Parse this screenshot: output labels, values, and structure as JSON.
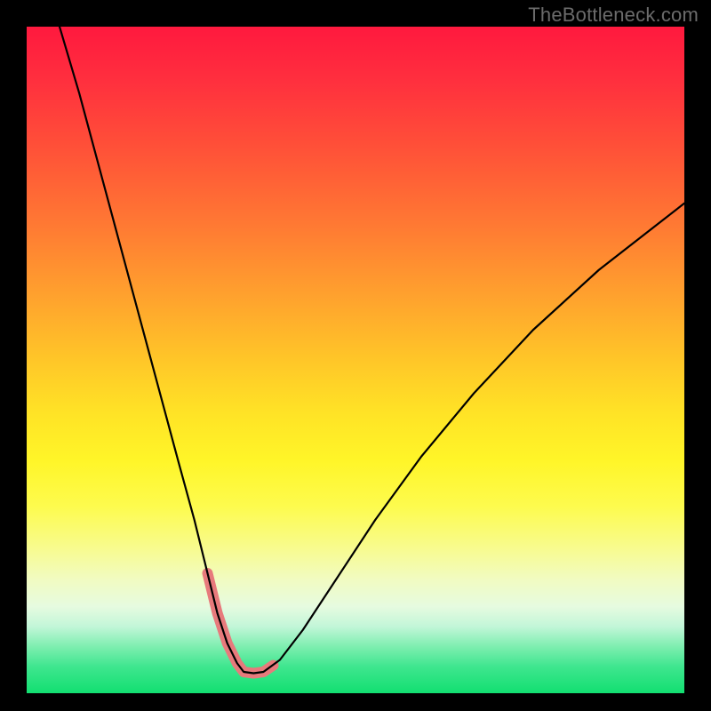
{
  "watermark": "TheBottleneck.com",
  "chart_data": {
    "type": "line",
    "title": "",
    "xlabel": "",
    "ylabel": "",
    "xlim": [
      0,
      100
    ],
    "ylim": [
      0,
      100
    ],
    "grid": false,
    "legend": false,
    "notes": "Unlabeled bottleneck curve on a green→red vertical gradient background. The minimum of the curve sits near x≈32, y≈3. A short salmon-colored segment highlights the region around the minimum. Values are estimated from pixel positions since no axis ticks are rendered.",
    "series": [
      {
        "name": "curve",
        "color": "#000000",
        "stroke_width": 2.2,
        "x": [
          5.0,
          8.0,
          11.0,
          14.0,
          17.0,
          20.0,
          23.0,
          25.5,
          27.5,
          29.0,
          30.5,
          32.0,
          33.0,
          34.5,
          36.0,
          38.5,
          42.0,
          47.0,
          53.0,
          60.0,
          68.0,
          77.0,
          87.0,
          100.0
        ],
        "y": [
          100.0,
          90.0,
          79.0,
          68.0,
          57.0,
          46.0,
          35.0,
          26.0,
          18.0,
          12.0,
          7.5,
          4.5,
          3.2,
          3.0,
          3.2,
          5.0,
          9.5,
          17.0,
          26.0,
          35.5,
          45.0,
          54.5,
          63.5,
          73.5
        ]
      },
      {
        "name": "highlight",
        "color": "#e77a7c",
        "stroke_width": 12,
        "linecap": "round",
        "x": [
          27.5,
          29.0,
          30.5,
          32.0,
          33.0,
          34.5,
          36.0,
          37.5
        ],
        "y": [
          18.0,
          12.0,
          7.5,
          4.5,
          3.2,
          3.0,
          3.2,
          4.2
        ]
      }
    ]
  }
}
